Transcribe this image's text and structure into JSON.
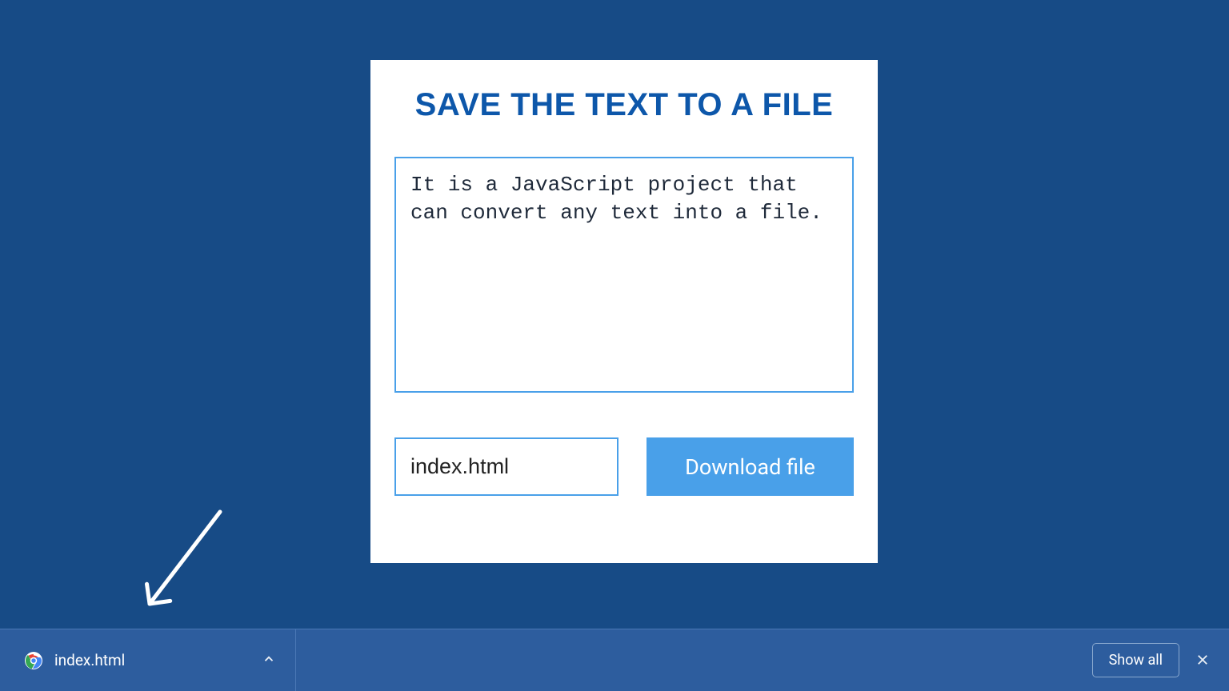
{
  "card": {
    "title": "SAVE THE TEXT TO A FILE",
    "textarea_value": "It is a JavaScript project that can convert any text into a file.",
    "filename_value": "index.html",
    "download_button_label": "Download file"
  },
  "downloads_bar": {
    "file_name": "index.html",
    "show_all_label": "Show all"
  }
}
